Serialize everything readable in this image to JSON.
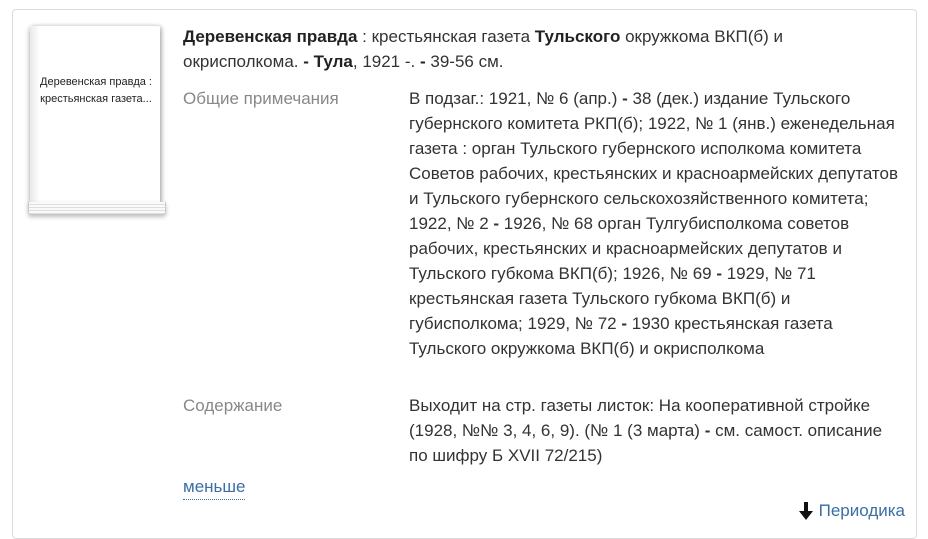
{
  "cover": {
    "title": "Деревенская правда : крестьянская газета..."
  },
  "record": {
    "title_parts": [
      {
        "text": "Деревенская правда",
        "bold": true
      },
      {
        "text": " : крестьянская газета ",
        "bold": false
      },
      {
        "text": "Тульского",
        "bold": true
      },
      {
        "text": " окружкома ВКП(б) и окрисполкома. ",
        "bold": false
      },
      {
        "text": "-",
        "bold": true
      },
      {
        "text": " ",
        "bold": false
      },
      {
        "text": "Тула",
        "bold": true
      },
      {
        "text": ", 1921 -. ",
        "bold": false
      },
      {
        "text": "-",
        "bold": true
      },
      {
        "text": " 39-56 см.",
        "bold": false
      }
    ]
  },
  "fields": {
    "notes": {
      "label": "Общие примечания",
      "value_parts": [
        {
          "text": "В подзаг.: 1921, № 6 (апр.) ",
          "bold": false
        },
        {
          "text": "-",
          "bold": true
        },
        {
          "text": " 38 (дек.) издание Тульского губернского комитета РКП(б); 1922, № 1 (янв.) еженедельная газета : орган Тульского губернского исполкома комитета Советов рабочих, крестьянских и красноармейских депутатов и Тульского губернского сельскохозяйственного комитета; 1922, № 2 ",
          "bold": false
        },
        {
          "text": "-",
          "bold": true
        },
        {
          "text": " 1926, № 68 орган Тулгубисполкома советов рабочих, крестьянских и красноармейских депутатов и Тульского губкома ВКП(б); 1926, № 69 ",
          "bold": false
        },
        {
          "text": "-",
          "bold": true
        },
        {
          "text": " 1929, № 71 крестьянская газета Тульского губкома ВКП(б) и губисполкома; 1929, № 72 ",
          "bold": false
        },
        {
          "text": "-",
          "bold": true
        },
        {
          "text": " 1930 крестьянская газета Тульского окружкома ВКП(б) и окрисполкома",
          "bold": false
        }
      ]
    },
    "contents": {
      "label": "Содержание",
      "value_parts": [
        {
          "text": "Выходит на стр. газеты листок: На кооперативной стройке (1928, №№ 3, 4, 6, 9). (№ 1 (3 марта) ",
          "bold": false
        },
        {
          "text": "-",
          "bold": true
        },
        {
          "text": " см. самост. описание по шифру Б XVII 72/215)",
          "bold": false
        }
      ]
    }
  },
  "actions": {
    "less_label": "меньше",
    "category_label": "Периодика",
    "category_icon": "arrow-down-icon"
  }
}
